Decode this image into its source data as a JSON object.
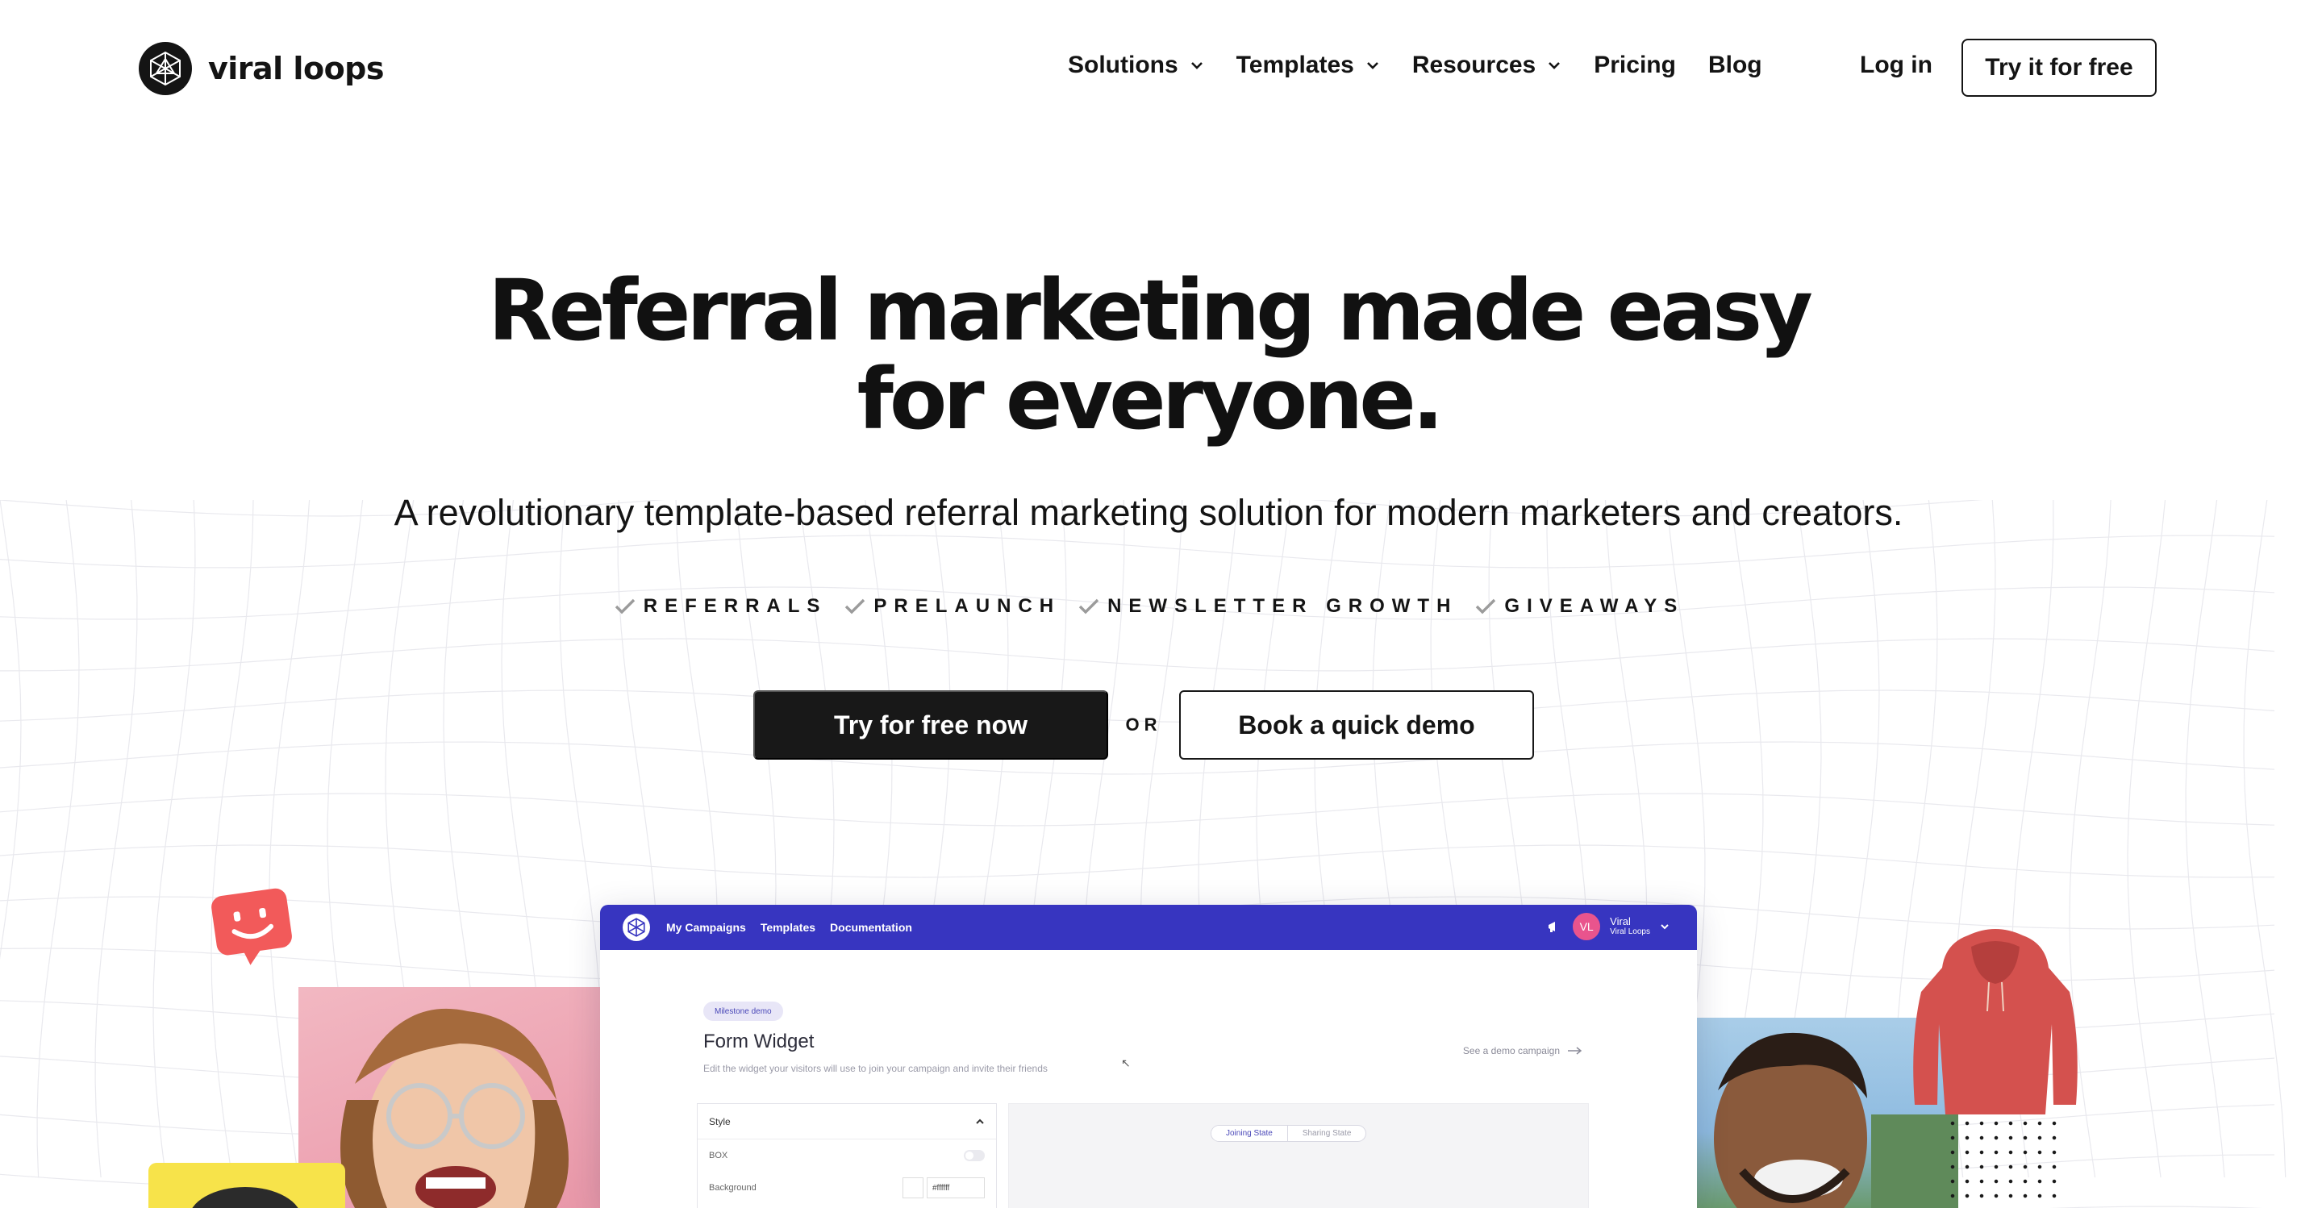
{
  "brand": {
    "name": "viral loops"
  },
  "nav": {
    "items": [
      {
        "label": "Solutions",
        "dropdown": true
      },
      {
        "label": "Templates",
        "dropdown": true
      },
      {
        "label": "Resources",
        "dropdown": true
      },
      {
        "label": "Pricing",
        "dropdown": false
      },
      {
        "label": "Blog",
        "dropdown": false
      }
    ],
    "login": "Log in",
    "cta": "Try it for free"
  },
  "hero": {
    "title_line1": "Referral marketing made easy",
    "title_line2": "for everyone.",
    "subtitle": "A revolutionary template-based referral marketing solution for modern marketers and creators.",
    "checks": [
      "REFERRALS",
      "PRELAUNCH",
      "NEWSLETTER GROWTH",
      "GIVEAWAYS"
    ],
    "primary_cta": "Try for free now",
    "or_text": "OR",
    "secondary_cta": "Book a quick demo"
  },
  "app_preview": {
    "nav": [
      "My Campaigns",
      "Templates",
      "Documentation"
    ],
    "user": {
      "initials": "VL",
      "name": "Viral",
      "org": "Viral Loops"
    },
    "pill": "Milestone demo",
    "title": "Form Widget",
    "description": "Edit the widget your visitors will use to join your campaign and invite their friends",
    "demo_link": "See a demo campaign",
    "style_panel": {
      "header": "Style",
      "box_label": "BOX",
      "background_label": "Background",
      "background_value": "#ffffff"
    },
    "state_tabs": [
      "Joining State",
      "Sharing State"
    ]
  },
  "colors": {
    "primary_dark": "#181818",
    "app_bar": "#3735c0",
    "avatar": "#e9548d",
    "chat_bubble": "#f25a5a",
    "hoodie": "#d4514e",
    "yellow": "#f7e34a"
  },
  "icons": [
    "viral-loops-logo-icon",
    "chevron-down-icon",
    "check-icon",
    "megaphone-icon",
    "arrow-right-icon",
    "chevron-up-icon",
    "smiley-chat-icon"
  ]
}
